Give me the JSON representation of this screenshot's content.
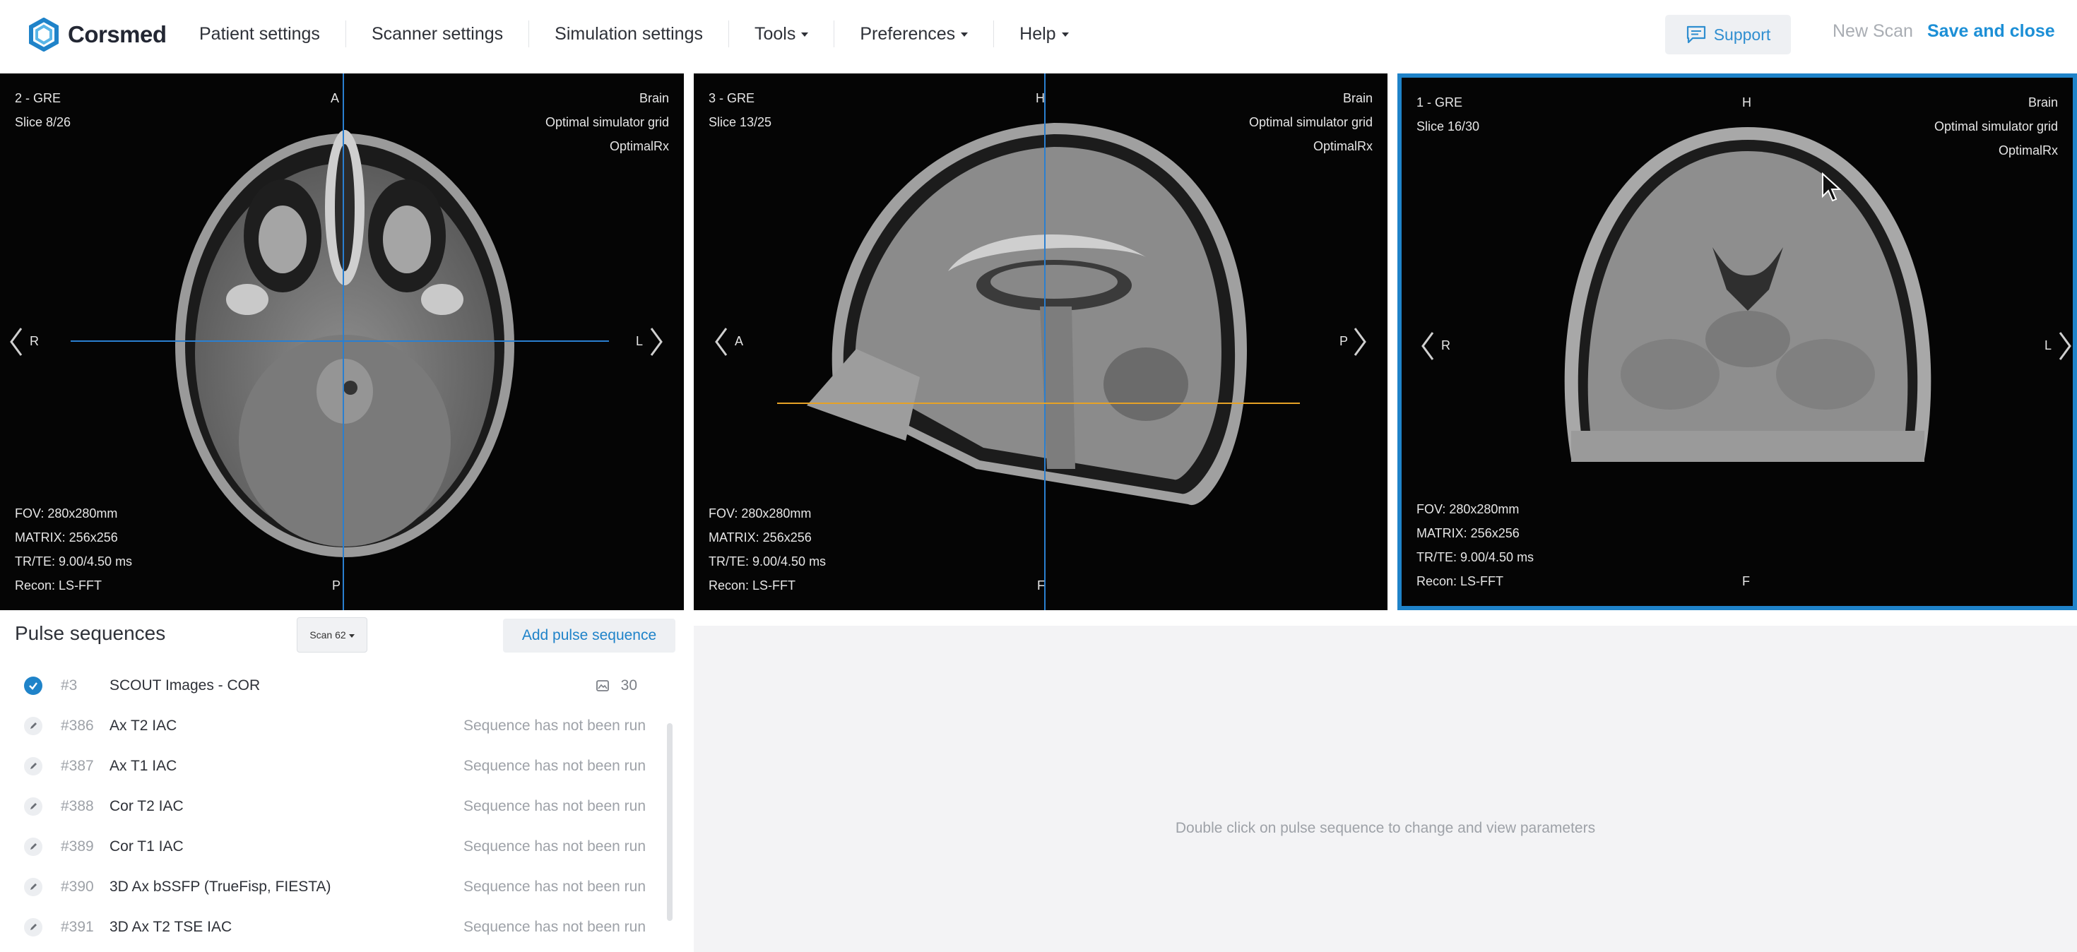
{
  "app": {
    "logo_text": "Corsmed",
    "brand_color": "#1f83c9"
  },
  "nav": {
    "items": [
      {
        "label": "Patient settings",
        "dropdown": false
      },
      {
        "label": "Scanner settings",
        "dropdown": false
      },
      {
        "label": "Simulation settings",
        "dropdown": false
      },
      {
        "label": "Tools",
        "dropdown": true
      },
      {
        "label": "Preferences",
        "dropdown": true
      },
      {
        "label": "Help",
        "dropdown": true
      }
    ],
    "support_label": "Support",
    "new_scan_label": "New Scan",
    "save_close_label": "Save and close"
  },
  "viewports": [
    {
      "series": "2 - GRE",
      "slice": "Slice 8/26",
      "region": "Brain",
      "grid": "Optimal simulator grid",
      "rx": "OptimalRx",
      "top_orient": "A",
      "bottom_orient": "P",
      "left_orient": "R",
      "right_orient": "L",
      "fov": "FOV: 280x280mm",
      "matrix": "MATRIX: 256x256",
      "trte": "TR/TE: 9.00/4.50 ms",
      "recon": "Recon: LS-FFT",
      "view": "axial"
    },
    {
      "series": "3 - GRE",
      "slice": "Slice 13/25",
      "region": "Brain",
      "grid": "Optimal simulator grid",
      "rx": "OptimalRx",
      "top_orient": "H",
      "bottom_orient": "F",
      "left_orient": "A",
      "right_orient": "P",
      "fov": "FOV: 280x280mm",
      "matrix": "MATRIX: 256x256",
      "trte": "TR/TE: 9.00/4.50 ms",
      "recon": "Recon: LS-FFT",
      "view": "sagittal"
    },
    {
      "series": "1 - GRE",
      "slice": "Slice 16/30",
      "region": "Brain",
      "grid": "Optimal simulator grid",
      "rx": "OptimalRx",
      "top_orient": "H",
      "bottom_orient": "F",
      "left_orient": "R",
      "right_orient": "L",
      "fov": "FOV: 280x280mm",
      "matrix": "MATRIX: 256x256",
      "trte": "TR/TE: 9.00/4.50 ms",
      "recon": "Recon: LS-FFT",
      "view": "coronal",
      "selected": true
    }
  ],
  "pulse": {
    "title": "Pulse sequences",
    "scan_badge": "Scan 62",
    "add_label": "Add pulse sequence",
    "rows": [
      {
        "num": "#3",
        "name": "SCOUT Images - COR",
        "status": "",
        "count": "30",
        "done": true
      },
      {
        "num": "#386",
        "name": "Ax T2 IAC",
        "status": "Sequence has not been run",
        "done": false
      },
      {
        "num": "#387",
        "name": "Ax T1 IAC",
        "status": "Sequence has not been run",
        "done": false
      },
      {
        "num": "#388",
        "name": "Cor T2 IAC",
        "status": "Sequence has not been run",
        "done": false
      },
      {
        "num": "#389",
        "name": "Cor T1 IAC",
        "status": "Sequence has not been run",
        "done": false
      },
      {
        "num": "#390",
        "name": "3D Ax bSSFP (TrueFisp, FIESTA)",
        "status": "Sequence has not been run",
        "done": false
      },
      {
        "num": "#391",
        "name": "3D Ax T2 TSE IAC",
        "status": "Sequence has not been run",
        "done": false
      }
    ]
  },
  "params": {
    "hint": "Double click on pulse sequence to change and view parameters"
  }
}
